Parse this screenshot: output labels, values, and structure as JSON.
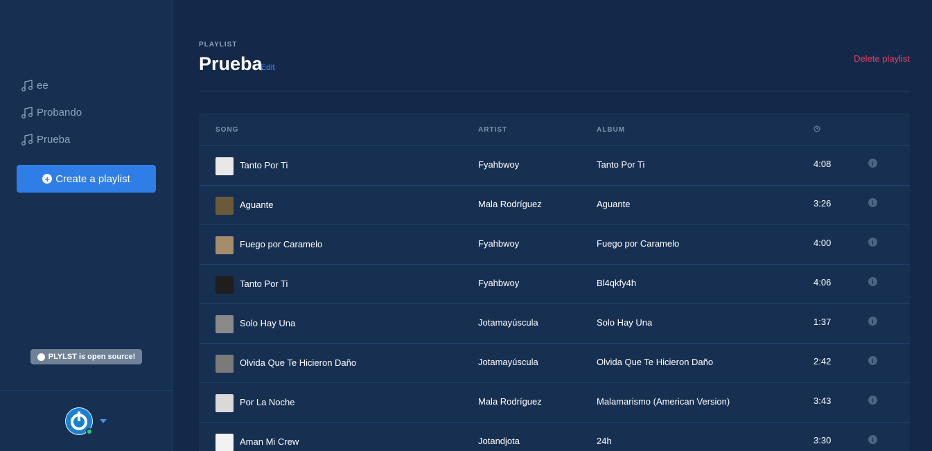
{
  "sidebar": {
    "playlists": [
      {
        "label": "ee"
      },
      {
        "label": "Probando"
      },
      {
        "label": "Prueba"
      }
    ],
    "create_button_label": "Create a playlist",
    "open_source_badge": "PLYLST is open source!"
  },
  "header": {
    "kicker": "PLAYLIST",
    "title": "Prueba",
    "edit_label": "Edit",
    "delete_label": "Delete playlist"
  },
  "table": {
    "columns": {
      "song": "SONG",
      "artist": "ARTIST",
      "album": "ALBUM",
      "duration_icon": "clock-icon"
    },
    "rows": [
      {
        "song": "Tanto Por Ti",
        "artist": "Fyahbwoy",
        "album": "Tanto Por Ti",
        "duration": "4:08",
        "cover_color": "#e8e8e8"
      },
      {
        "song": "Aguante",
        "artist": "Mala Rodríguez",
        "album": "Aguante",
        "duration": "3:26",
        "cover_color": "#6b5a3a"
      },
      {
        "song": "Fuego por Caramelo",
        "artist": "Fyahbwoy",
        "album": "Fuego por Caramelo",
        "duration": "4:00",
        "cover_color": "#a58c6b"
      },
      {
        "song": "Tanto Por Ti",
        "artist": "Fyahbwoy",
        "album": "Bl4qkfy4h",
        "duration": "4:06",
        "cover_color": "#1e1e1e"
      },
      {
        "song": "Solo Hay Una",
        "artist": "Jotamayúscula",
        "album": "Solo Hay Una",
        "duration": "1:37",
        "cover_color": "#8a8a8a"
      },
      {
        "song": "Olvida Que Te Hicieron Daño",
        "artist": "Jotamayúscula",
        "album": "Olvida Que Te Hicieron Daño",
        "duration": "2:42",
        "cover_color": "#7a7a7a"
      },
      {
        "song": "Por La Noche",
        "artist": "Mala Rodríguez",
        "album": "Malamarismo (American Version)",
        "duration": "3:43",
        "cover_color": "#d9d9d9"
      },
      {
        "song": "Aman Mi Crew",
        "artist": "Jotandjota",
        "album": "24h",
        "duration": "3:30",
        "cover_color": "#f2f2f2"
      }
    ]
  },
  "colors": {
    "accent": "#2f7ee8",
    "danger": "#e5405e",
    "background": "#14294a",
    "sidebar": "#173052"
  }
}
